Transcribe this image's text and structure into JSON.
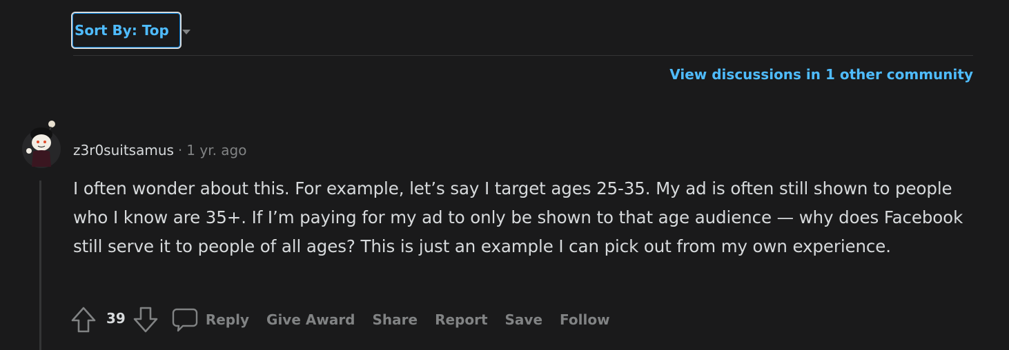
{
  "sort": {
    "label": "Sort By: Top"
  },
  "links": {
    "view_discussions": "View discussions in 1 other community"
  },
  "comment": {
    "username": "z3r0suitsamus",
    "separator": "·",
    "timestamp": "1 yr. ago",
    "body": "I often wonder about this. For example, let’s say I target ages 25-35. My ad is often still shown to people who I know are 35+. If I’m paying for my ad to only be shown to that age audience — why does Facebook still serve it to people of all ages? This is just an example I can pick out from my own experience.",
    "votes": "39",
    "actions": {
      "reply": "Reply",
      "give_award": "Give Award",
      "share": "Share",
      "report": "Report",
      "save": "Save",
      "follow": "Follow"
    }
  },
  "icons": {
    "upvote": "arrow-up-icon",
    "downvote": "arrow-down-icon",
    "reply": "comment-bubble-icon",
    "avatar": "snoo-avatar",
    "sort_caret": "caret-down-icon"
  },
  "colors": {
    "background": "#1a1a1b",
    "link": "#4fbcff",
    "text": "#d7dadc",
    "muted": "#818384",
    "divider": "#343536"
  }
}
